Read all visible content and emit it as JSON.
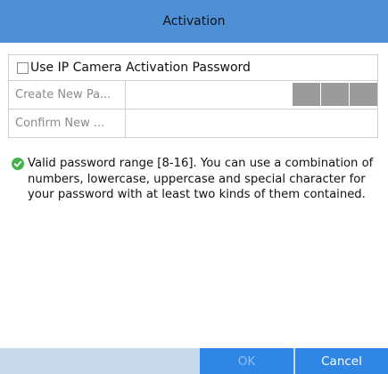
{
  "dialog": {
    "title": "Activation",
    "title_bar_color": "#4e8fd6",
    "checkbox": {
      "label": "Use IP Camera Activation Password",
      "checked": false
    },
    "fields": [
      {
        "label": "Create New Pa...",
        "value": "",
        "strength_segments": 3,
        "strength_color": "#9b9b9b"
      },
      {
        "label": "Confirm New ...",
        "value": ""
      }
    ],
    "note": {
      "icon": "check-circle-icon",
      "icon_color": "#45b24a",
      "text": "Valid password range [8-16]. You can use a combination of numbers, lowercase, uppercase and special character for your password with at least two kinds of them contained."
    },
    "buttons": {
      "ok_label": "OK",
      "ok_enabled": false,
      "cancel_label": "Cancel",
      "button_color": "#2f86e4"
    }
  }
}
